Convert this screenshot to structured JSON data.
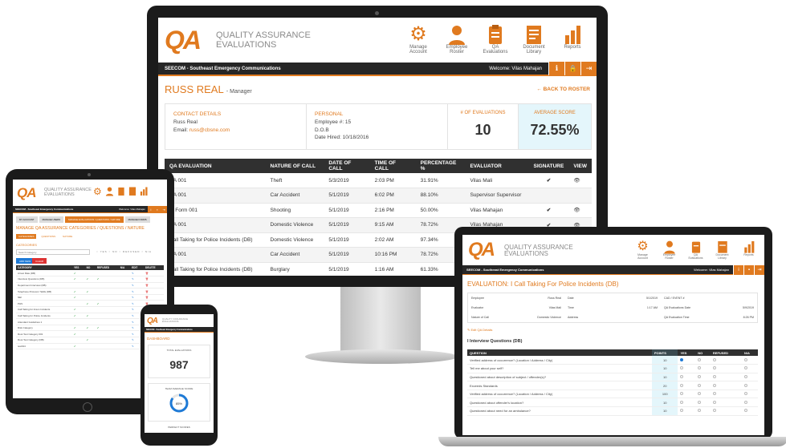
{
  "brand": {
    "logo": "QA",
    "subtitle_line1": "QUALITY ASSURANCE",
    "subtitle_line2": "EVALUATIONS",
    "accent": "#e07a1f",
    "dark": "#262626",
    "highlight": "#e4f6fb"
  },
  "nav": [
    {
      "label_line1": "Manage",
      "label_line2": "Account",
      "icon": "gear-icon"
    },
    {
      "label_line1": "Employee",
      "label_line2": "Roster",
      "icon": "user-icon"
    },
    {
      "label_line1": "QA",
      "label_line2": "Evaluations",
      "icon": "clipboard-icon"
    },
    {
      "label_line1": "Document",
      "label_line2": "Library",
      "icon": "document-icon"
    },
    {
      "label_line1": "Reports",
      "label_line2": "",
      "icon": "bar-chart-icon"
    }
  ],
  "bar": {
    "org": "SEECOM - Southeast Emergency Communications",
    "welcome": "Welcome: Vilas Mahajan"
  },
  "monitor": {
    "employee_name": "RUSS REAL",
    "employee_role": "- Manager",
    "back_link": "BACK TO ROSTER",
    "contact_title": "CONTACT DETAILS",
    "contact_name": "Russ Real",
    "contact_email_label": "Email:",
    "contact_email": "russ@cbsne.com",
    "personal_title": "PERSONAL",
    "employee_no": "Employee #: 15",
    "dob": "D.O.B",
    "date_hired": "Date Hired: 10/18/2016",
    "evals_title": "# OF EVALUATIONS",
    "evals_value": "10",
    "avg_title": "AVERAGE SCORE",
    "avg_value": "72.55%",
    "table_headers": [
      "QA EVALUATION",
      "NATURE OF CALL",
      "DATE OF CALL",
      "TIME OF CALL",
      "PERCENTAGE %",
      "EVALUATOR",
      "SIGNATURE",
      "VIEW"
    ],
    "rows": [
      {
        "qa": "NA 001",
        "nature": "Theft",
        "date": "5/3/2019",
        "time": "2:03 PM",
        "pct": "31.91%",
        "evaluator": "Vilas Mali",
        "signed": true
      },
      {
        "qa": "NA 001",
        "nature": "Car Accident",
        "date": "5/1/2019",
        "time": "6:02 PM",
        "pct": "88.10%",
        "evaluator": "Supervisor Supervisor",
        "signed": false
      },
      {
        "qa": "ry Form 001",
        "nature": "Shooting",
        "date": "5/1/2019",
        "time": "2:16 PM",
        "pct": "50.00%",
        "evaluator": "Vilas Mahajan",
        "signed": true
      },
      {
        "qa": "NA 001",
        "nature": "Domestic Violence",
        "date": "5/1/2019",
        "time": "9:15 AM",
        "pct": "78.72%",
        "evaluator": "Vilas Mahajan",
        "signed": true
      },
      {
        "qa": "Call Taking for Police Incidents (DB)",
        "nature": "Domestic Violence",
        "date": "5/1/2019",
        "time": "2:02 AM",
        "pct": "97.34%",
        "evaluator": "",
        "signed": false
      },
      {
        "qa": "NA 001",
        "nature": "Car Accident",
        "date": "5/1/2019",
        "time": "10:16 PM",
        "pct": "78.72%",
        "evaluator": "",
        "signed": false
      },
      {
        "qa": "Call Taking for Police Incidents (DB)",
        "nature": "Burglary",
        "date": "5/1/2019",
        "time": "1:16 AM",
        "pct": "61.33%",
        "evaluator": "",
        "signed": false
      }
    ]
  },
  "laptop": {
    "eval_title": "EVALUATION: I Call Taking For Police Incidents (DB)",
    "info": [
      [
        "Employee",
        "Russ Real",
        "Date",
        "5/1/2019",
        "CAD / EVENT #",
        ""
      ],
      [
        "Evaluator",
        "Vilas Mali",
        "Time",
        "1:17 AM",
        "QA Evaluations Date",
        "5/9/2019"
      ],
      [
        "Nature of Call",
        "Domestic Violence",
        "Address",
        "",
        "QA Evaluation Time",
        "8:26 PM"
      ]
    ],
    "edit_link": "Edit QA Details",
    "section": "I Interview Questions (DB)",
    "q_headers": [
      "QUESTION",
      "POINTS",
      "YES",
      "NO",
      "REFUSED",
      "N/A"
    ],
    "questions": [
      {
        "q": "Verified address of occurrence? (Location / Address / City)",
        "pts": "10"
      },
      {
        "q": "Tell me about your self?",
        "pts": "10"
      },
      {
        "q": "Questioned about description of subject / offender(s)?",
        "pts": "10"
      },
      {
        "q": "Exceeds Standards",
        "pts": "20"
      },
      {
        "q": "Verified address of occurrence? (Location / Address / City)",
        "pts": "100"
      },
      {
        "q": "Questioned about offender's location?",
        "pts": "10"
      },
      {
        "q": "Questioned about need for an ambulance?",
        "pts": "10"
      }
    ]
  },
  "tablet": {
    "tabs": [
      "MY ACCOUNT",
      "MANAGE USERS",
      "MANAGE EVALUATIONS / QUESTIONS / NATURE",
      "MANAGE FORMS"
    ],
    "page_title": "MANAGE QA ASSURANCE CATEGORIES / QUESTIONS / NATURE",
    "sub_tabs": [
      "CATEGORIES",
      "QUESTIONS",
      "NATURE"
    ],
    "categories_label": "CATEGORIES",
    "search_placeholder": "Search Category",
    "btn_add": "ADD NEW",
    "btn_del": "CLEAR",
    "col_headers": [
      "CATEGORY",
      "YES",
      "NO",
      "REFUSED",
      "N/A",
      "EDIT",
      "DELETE"
    ],
    "rows": [
      "Arrest Rate (DB)",
      "Interview Questions (DB)",
      "Department Interview (DB)",
      "Telephone Protocol / Skills (DB)",
      "NEI",
      "PHS",
      "Call Taking for Arson Incidents",
      "Call Taking for Police Incidents",
      "Attendant Guidelines 1",
      "Risk Category",
      "Root Test Category 001",
      "Root Test Category (DB)",
      "test014"
    ]
  },
  "phone": {
    "dashboard": "DASHBOARD",
    "total_label": "TOTAL EVALUATIONS",
    "total_value": "987",
    "team_label": "TEAM AVERAGE SCORE",
    "team_value": "85%",
    "perfect_label": "PERFECT SCORES"
  }
}
